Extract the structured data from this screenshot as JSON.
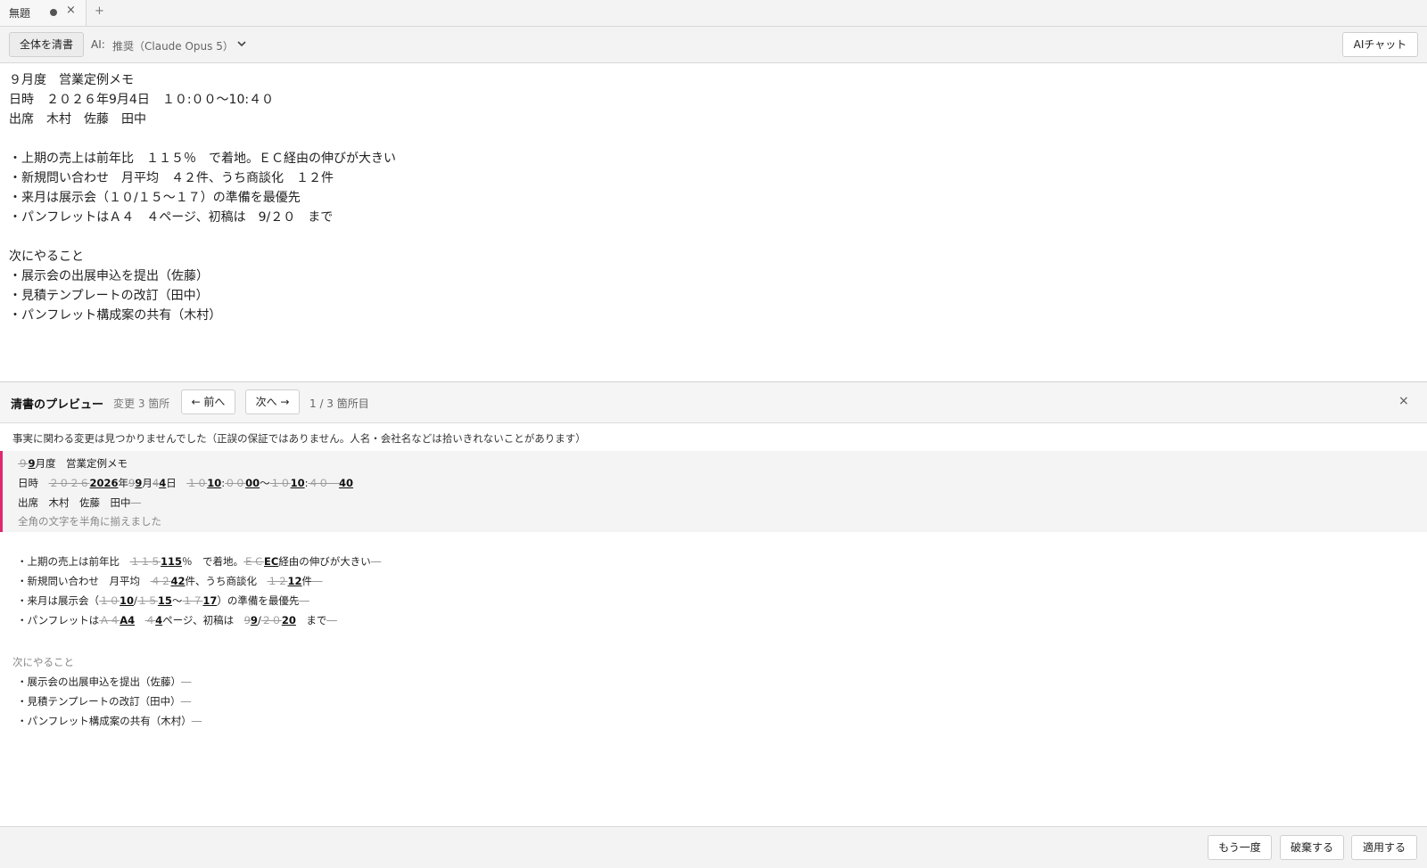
{
  "tab": {
    "title": "無題",
    "close_glyph": "×",
    "add_glyph": "+"
  },
  "toolbar": {
    "cleanup_label": "全体を清書",
    "ai_label": "AI:",
    "ai_model": "推奨（Claude Opus 5）",
    "aichat_label": "AIチャット"
  },
  "editor": {
    "lines": [
      "９月度　営業定例メモ",
      "日時　２０２６年9月4日　１０:００〜10:４０",
      "出席　木村　佐藤　田中",
      "",
      "・上期の売上は前年比　１１５％　で着地。ＥＣ経由の伸びが大きい",
      "・新規問い合わせ　月平均　４２件、うち商談化　１２件",
      "・来月は展示会（１０/１５〜１７）の準備を最優先",
      "・パンフレットはＡ４　４ページ、初稿は　9/２０　まで",
      "",
      "次にやること",
      "・展示会の出展申込を提出（佐藤）",
      "・見積テンプレートの改訂（田中）",
      "・パンフレット構成案の共有（木村）"
    ]
  },
  "preview": {
    "title": "清書のプレビュー",
    "change_count": "変更 3 箇所",
    "prev_label": "← 前へ",
    "next_label": "次へ →",
    "position": "1 / 3 箇所目",
    "close_glyph": "×",
    "facts_note": "事実に関わる変更は見つかりませんでした（正誤の保証ではありません。人名・会社名などは拾いきれないことがあります）",
    "block1": {
      "line1": {
        "del_a": "９",
        "ins_a": "9",
        "rest": "月度　営業定例メモ"
      },
      "line2": {
        "p0": "日時　",
        "d1": "２０２６",
        "i1": "2026",
        "p1": "年",
        "d2": "9",
        "i2": "9",
        "p2": "月",
        "d3": "4",
        "i3": "4",
        "p3": "日　",
        "d4": "１０",
        "i4": "10",
        "p4": ":",
        "d5": "００",
        "i5": "00",
        "p5": "〜",
        "d6": "１０",
        "i6": "10",
        "p6": ":",
        "d7": "４０　",
        "i7": "40"
      },
      "line3": {
        "text": "出席　木村　佐藤　田中",
        "del": "—"
      },
      "caption": "全角の文字を半角に揃えました"
    },
    "block2": {
      "line1": {
        "p0": "・上期の売上は前年比　",
        "d1": "１１５",
        "i1": "115",
        "p1": "％　で着地。",
        "d2": "ＥＣ",
        "i2": "EC",
        "p2": "経由の伸びが大きい",
        "d3": "—"
      },
      "line2": {
        "p0": "・新規問い合わせ　月平均　",
        "d1": "４２",
        "i1": "42",
        "p1": "件、うち商談化　",
        "d2": "１２",
        "i2": "12",
        "p2": "件",
        "d3": "—"
      },
      "line3": {
        "p0": "・来月は展示会（",
        "d1": "１０",
        "i1": "10",
        "p1": "/",
        "d2": "１５",
        "i2": "15",
        "p2": "〜",
        "d3": "１７",
        "i3": "17",
        "p3": "）の準備を最優先",
        "d4": "—"
      },
      "line4": {
        "p0": "・パンフレットは",
        "d1": "Ａ４",
        "i1": "A4",
        "p1": "　",
        "d2": "４",
        "i2": "4",
        "p2": "ページ、初稿は　",
        "d3": "9",
        "i3": "9",
        "p3": "/",
        "d4": "２０",
        "i4": "20",
        "p4": "　まで",
        "d5": "—"
      }
    },
    "block3": {
      "heading": "次にやること",
      "items": [
        {
          "text": "・展示会の出展申込を提出（佐藤）",
          "del": "—"
        },
        {
          "text": "・見積テンプレートの改訂（田中）",
          "del": "—"
        },
        {
          "text": "・パンフレット構成案の共有（木村）",
          "del": "—"
        }
      ]
    }
  },
  "footer": {
    "retry_label": "もう一度",
    "discard_label": "破棄する",
    "apply_label": "適用する"
  },
  "colors": {
    "accent": "#e0286e",
    "deleted_text": "#999999"
  }
}
